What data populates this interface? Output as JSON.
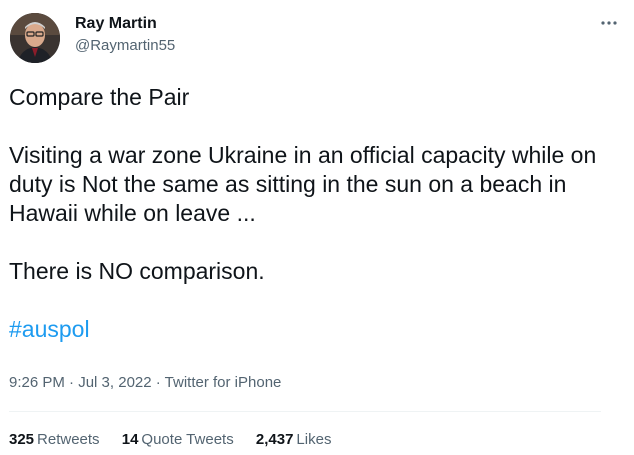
{
  "author": {
    "display_name": "Ray Martin",
    "handle": "@Raymartin55"
  },
  "icons": {
    "more": "more-horizontal-icon"
  },
  "tweet": {
    "line1": "Compare the Pair",
    "line2": "Visiting a war zone Ukraine in an official capacity while on duty is Not the same as sitting in the sun on a beach in Hawaii while on leave ...",
    "line3": "There is NO comparison.",
    "hashtag": "#auspol"
  },
  "meta": {
    "time": "9:26 PM",
    "separator": " · ",
    "date": "Jul 3, 2022",
    "source": "Twitter for iPhone"
  },
  "stats": {
    "retweets_count": "325",
    "retweets_label": "Retweets",
    "quote_count": "14",
    "quote_label": "Quote Tweets",
    "likes_count": "2,437",
    "likes_label": "Likes"
  },
  "colors": {
    "link": "#1d9bf0",
    "secondary_text": "#536471",
    "primary_text": "#0f1419"
  }
}
